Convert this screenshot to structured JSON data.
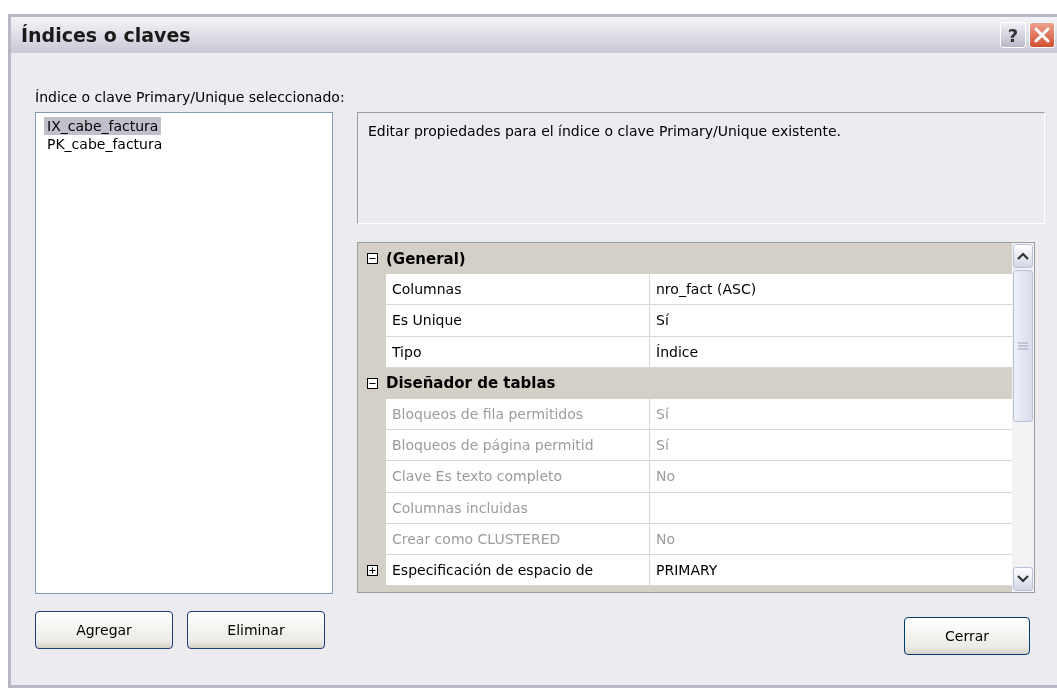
{
  "window": {
    "title": "Índices o claves",
    "help_button": "?"
  },
  "list_label": "Índice o clave Primary/Unique seleccionado:",
  "keys": [
    {
      "name": "IX_cabe_factura",
      "selected": true
    },
    {
      "name": "PK_cabe_factura",
      "selected": false
    }
  ],
  "description": "Editar propiedades para el índice o clave Primary/Unique existente.",
  "property_grid": {
    "categories": [
      {
        "name": "(General)",
        "expanded": true,
        "properties": [
          {
            "kind": "plain",
            "name": "Columnas",
            "value": "nro_fact (ASC)",
            "disabled": false
          },
          {
            "kind": "plain",
            "name": "Es Unique",
            "value": "Sí",
            "disabled": false
          },
          {
            "kind": "plain",
            "name": "Tipo",
            "value": "Índice",
            "disabled": false
          }
        ]
      },
      {
        "name": "Diseñador de tablas",
        "expanded": true,
        "properties": [
          {
            "kind": "plain",
            "name": "Bloqueos de fila permitidos",
            "value": "Sí",
            "disabled": true
          },
          {
            "kind": "plain",
            "name": "Bloqueos de página permitid",
            "value": "Sí",
            "disabled": true
          },
          {
            "kind": "plain",
            "name": "Clave Es texto completo",
            "value": "No",
            "disabled": true
          },
          {
            "kind": "plain",
            "name": "Columnas incluidas",
            "disabled": true
          },
          {
            "kind": "plain",
            "name": "Crear como CLUSTERED",
            "value": "No",
            "disabled": true
          },
          {
            "kind": "expandable",
            "name": "Especificación de espacio de",
            "value": "PRIMARY",
            "disabled": false,
            "expanded": false
          }
        ]
      }
    ]
  },
  "buttons": {
    "add": "Agregar",
    "remove": "Eliminar",
    "close": "Cerrar"
  }
}
